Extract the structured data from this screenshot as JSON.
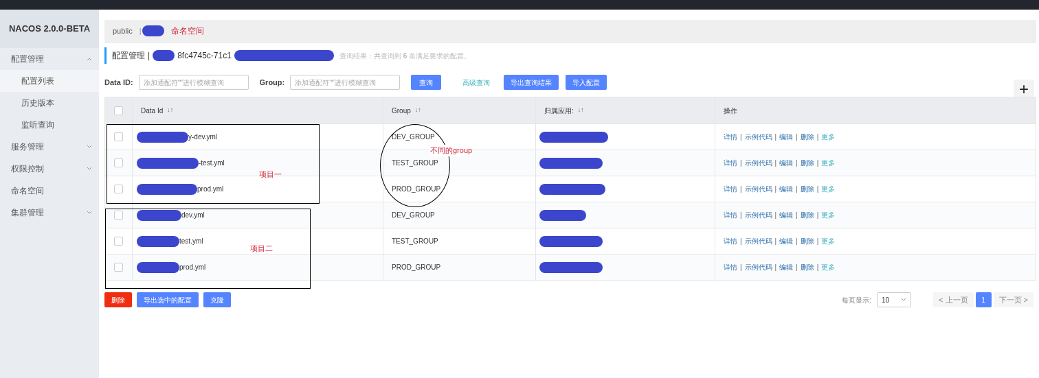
{
  "sidebar": {
    "title": "NACOS 2.0.0-BETA",
    "items": [
      {
        "label": "配置管理",
        "kind": "group",
        "expanded": true,
        "children": [
          {
            "label": "配置列表",
            "selected": true
          },
          {
            "label": "历史版本",
            "selected": false
          },
          {
            "label": "监听查询",
            "selected": false
          }
        ]
      },
      {
        "label": "服务管理",
        "kind": "group",
        "expanded": false
      },
      {
        "label": "权限控制",
        "kind": "group",
        "expanded": false
      },
      {
        "label": "命名空间",
        "kind": "link"
      },
      {
        "label": "集群管理",
        "kind": "group",
        "expanded": false
      }
    ]
  },
  "namespace_bar": {
    "items": [
      "public"
    ],
    "separator": "|",
    "annotation": "命名空间"
  },
  "title_bar": {
    "title": "配置管理",
    "separator": "|",
    "namespace_id": "8fc4745c-71c1",
    "result": "查询结果：共查询到 **6** 条满足要求的配置。"
  },
  "search": {
    "fields": [
      {
        "label": "Data ID:",
        "placeholder": "添加通配符'*'进行模糊查询"
      },
      {
        "label": "Group:",
        "placeholder": "添加通配符'*'进行模糊查询"
      }
    ],
    "query_button": "查询",
    "advanced_link": "高级查询",
    "buttons": [
      "导出查询结果",
      "导入配置"
    ],
    "add_icon": "+"
  },
  "table": {
    "select_all_checked": false,
    "columns": [
      "Data Id",
      "Group",
      "归属应用:",
      "操作"
    ],
    "sort_icon": "↓↑",
    "rows": [
      {
        "data_id": "y-dev.yml",
        "group": "DEV_GROUP",
        "checked": false,
        "actions": [
          "详情",
          "示例代码",
          "编辑",
          "删除",
          "更多"
        ]
      },
      {
        "data_id": "-test.yml",
        "group": "TEST_GROUP",
        "checked": false,
        "actions": [
          "详情",
          "示例代码",
          "编辑",
          "删除",
          "更多"
        ]
      },
      {
        "data_id": "prod.yml",
        "group": "PROD_GROUP",
        "checked": false,
        "actions": [
          "详情",
          "示例代码",
          "编辑",
          "删除",
          "更多"
        ]
      },
      {
        "data_id": "dev.yml",
        "group": "DEV_GROUP",
        "checked": false,
        "actions": [
          "详情",
          "示例代码",
          "编辑",
          "删除",
          "更多"
        ]
      },
      {
        "data_id": "test.yml",
        "group": "TEST_GROUP",
        "checked": false,
        "actions": [
          "详情",
          "示例代码",
          "编辑",
          "删除",
          "更多"
        ]
      },
      {
        "data_id": "prod.yml",
        "group": "PROD_GROUP",
        "checked": false,
        "actions": [
          "详情",
          "示例代码",
          "编辑",
          "删除",
          "更多"
        ]
      }
    ],
    "action_separator": "|"
  },
  "footer": {
    "buttons": [
      {
        "label": "删除",
        "kind": "danger"
      },
      {
        "label": "导出选中的配置",
        "kind": "primary"
      },
      {
        "label": "克隆",
        "kind": "primary"
      }
    ],
    "page_size_label": "每页显示:",
    "page_size": "10",
    "prev": "< 上一页",
    "pages": [
      {
        "label": "1",
        "selected": true
      }
    ],
    "next": "下一页 >"
  },
  "annotations": [
    "不同的group",
    "项目一",
    "项目二"
  ]
}
